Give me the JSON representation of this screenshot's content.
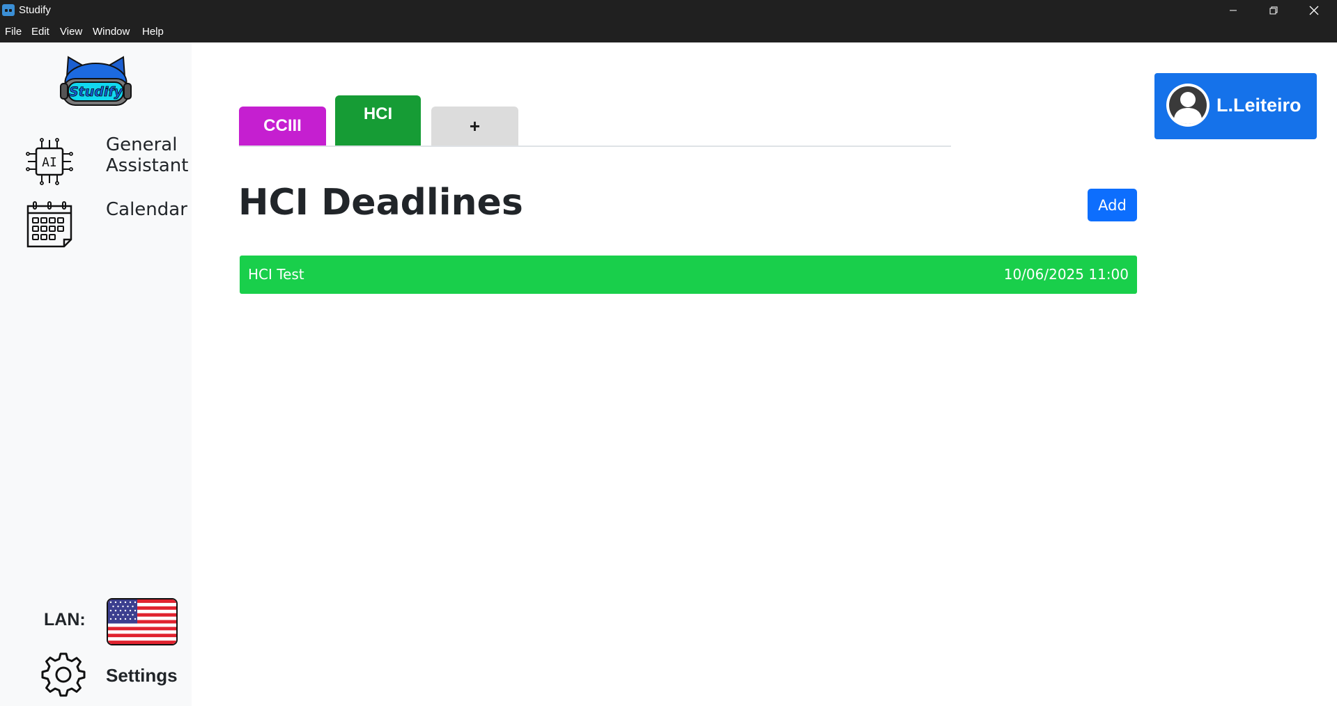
{
  "window": {
    "title": "Studify",
    "app_icon": "studify-app-icon",
    "controls": [
      "minimize-icon",
      "restore-icon",
      "close-icon"
    ]
  },
  "menubar": {
    "items": [
      {
        "label": "File"
      },
      {
        "label": "Edit"
      },
      {
        "label": "View"
      },
      {
        "label": "Window"
      },
      {
        "label": "Help"
      }
    ]
  },
  "sidebar": {
    "logo": {
      "text": "Studify",
      "icon": "studify-cat-logo"
    },
    "nav": [
      {
        "label": "General\nAssistant",
        "icon": "ai-chip-icon"
      },
      {
        "label": "Calendar",
        "icon": "calendar-icon"
      }
    ],
    "language": {
      "label": "LAN:",
      "flag": "us-flag-icon"
    },
    "settings": {
      "label": "Settings",
      "icon": "gear-icon"
    }
  },
  "tabs": [
    {
      "label": "CCIII",
      "color": "#c51fd0",
      "active": false
    },
    {
      "label": "HCI",
      "color": "#169c35",
      "active": true
    },
    {
      "label": "+",
      "color": "#dcdcdc",
      "active": false
    }
  ],
  "user": {
    "name": "L.Leiteiro",
    "icon": "user-avatar-icon",
    "color": "#1572ea"
  },
  "main": {
    "title": "HCI Deadlines",
    "add_label": "Add",
    "deadlines": [
      {
        "name": "HCI Test",
        "date": "10/06/2025 11:00",
        "color": "#19cf4b"
      }
    ]
  }
}
